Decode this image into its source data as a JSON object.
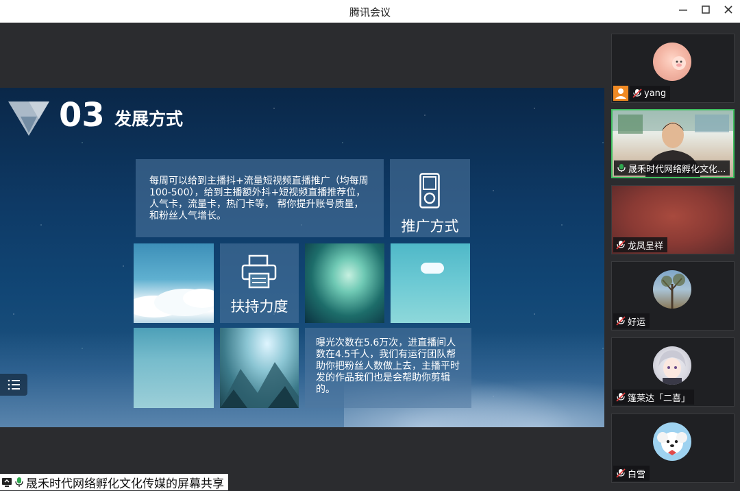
{
  "window": {
    "title": "腾讯会议",
    "minimize_icon": "minimize-icon",
    "maximize_icon": "maximize-icon",
    "close_icon": "close-icon"
  },
  "slide": {
    "section_number": "03",
    "section_title": "发展方式",
    "intro_text": "每周可以给到主播抖+流量短视频直播推广（均每周100-500），给到主播额外抖+短视频直播推荐位，人气卡，流量卡，热门卡等， 帮你提升账号质量，和粉丝人气增长。",
    "promo_label": "推广方式",
    "support_label": "扶持力度",
    "stats_text": "曝光次数在5.6万次，进直播间人数在4.5千人，我们有运行团队帮助你把粉丝人数做上去，主播平时发的作品我们也是会帮助你剪辑的。"
  },
  "share_bar": {
    "label": "晟禾时代网络孵化文化传媒的屏幕共享"
  },
  "participants": [
    {
      "name": "yang",
      "muted": true,
      "is_host": true
    },
    {
      "name": "晟禾时代网络孵化文化...",
      "muted": false,
      "is_host": false,
      "video": true
    },
    {
      "name": "龙凤呈祥",
      "muted": true,
      "is_host": false
    },
    {
      "name": "好运",
      "muted": true,
      "is_host": false
    },
    {
      "name": "篷莱达「二喜」",
      "muted": true,
      "is_host": false
    },
    {
      "name": "白雪",
      "muted": true,
      "is_host": false
    }
  ],
  "colors": {
    "active_speaker_border": "#3fbf5f",
    "host_badge": "#f08a24",
    "mute_red": "#e03b3b"
  }
}
